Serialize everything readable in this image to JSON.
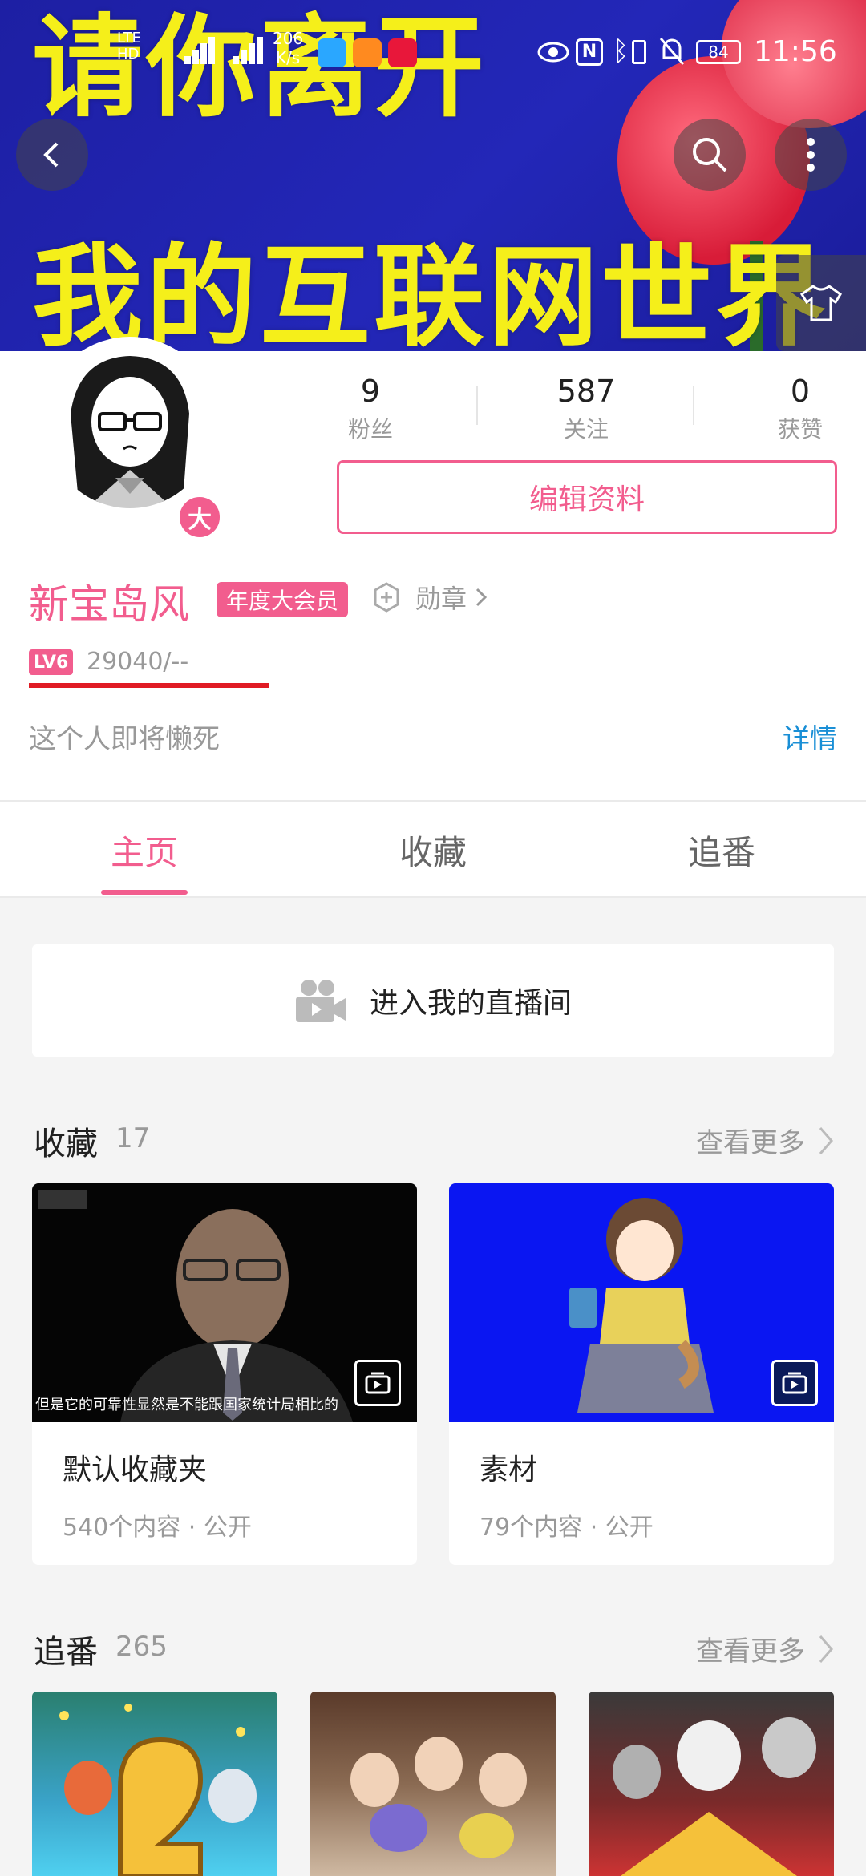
{
  "banner": {
    "line1": "请你离开",
    "line2": "我的互联网世界"
  },
  "status_bar": {
    "network_speed": "206",
    "network_unit": "K/s",
    "battery": "84",
    "time": "11:56"
  },
  "profile": {
    "fans_count": "9",
    "fans_label": "粉丝",
    "following_count": "587",
    "following_label": "关注",
    "likes_count": "0",
    "likes_label": "获赞",
    "edit_button": "编辑资料",
    "username": "新宝岛风",
    "vip_tag": "年度大会员",
    "vip_badge": "大",
    "medal_label": "勋章",
    "level": "LV6",
    "exp": "29040/--",
    "bio": "这个人即将懒死",
    "detail_link": "详情"
  },
  "tabs": {
    "home": "主页",
    "favorites": "收藏",
    "bangumi": "追番"
  },
  "live": {
    "label": "进入我的直播间"
  },
  "favorites_section": {
    "title": "收藏",
    "count": "17",
    "see_more": "查看更多",
    "items": [
      {
        "name": "默认收藏夹",
        "meta": "540个内容 · 公开",
        "caption": "但是它的可靠性显然是不能跟国家统计局相比的"
      },
      {
        "name": "素材",
        "meta": "79个内容 · 公开"
      }
    ]
  },
  "bangumi_section": {
    "title": "追番",
    "count": "265",
    "see_more": "查看更多"
  },
  "colors": {
    "accent": "#f25d8e",
    "link": "#1a8fd6",
    "banner_bg": "#2327b8",
    "banner_text": "#f5ef1a"
  }
}
